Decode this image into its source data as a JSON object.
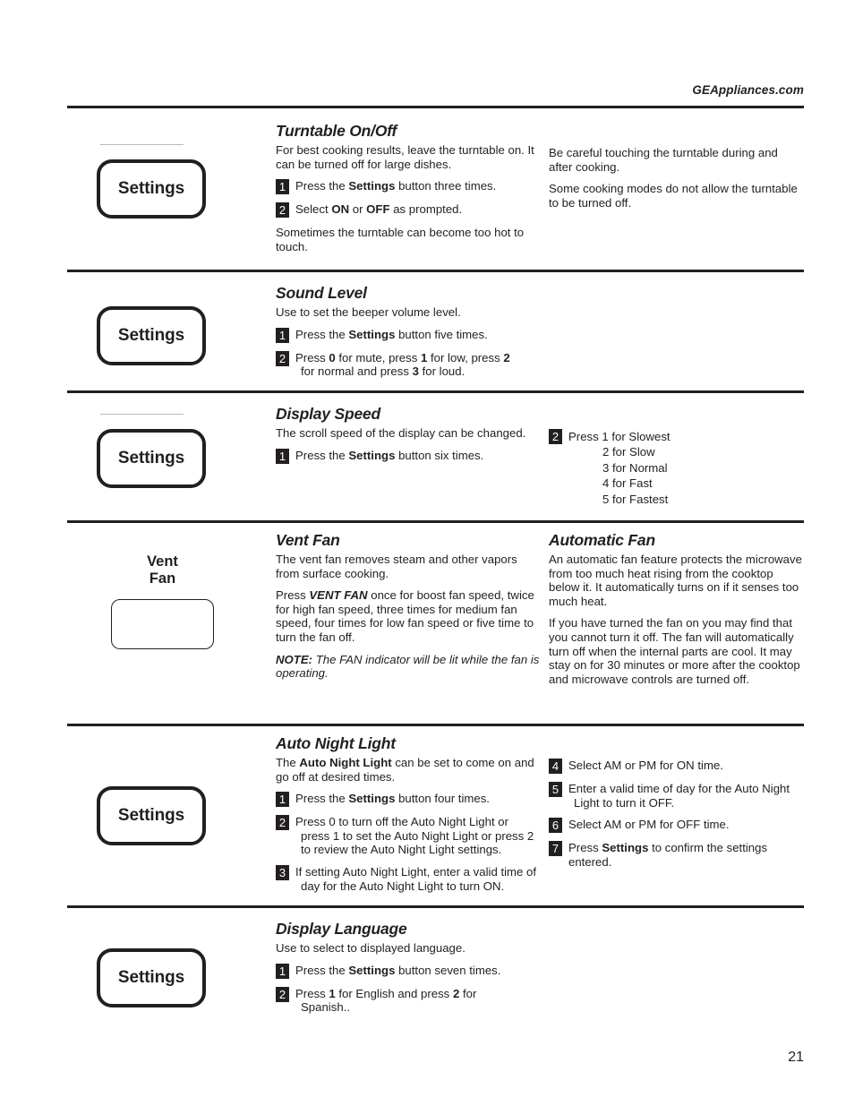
{
  "header": {
    "site": "GEAppliances.com"
  },
  "page_number": "21",
  "sections": [
    {
      "id": "turntable",
      "control": {
        "type": "settings-button",
        "label": "Settings",
        "hairline": true
      },
      "title": "Turntable On/Off",
      "intro": "For best cooking results, leave the turntable on. It can be turned off for large dishes.",
      "steps": [
        {
          "num": "1",
          "pre": "Press the ",
          "bold": "Settings",
          "post": " button three times."
        },
        {
          "num": "2",
          "pre": "Select ",
          "bold": "ON",
          "mid": " or ",
          "bold2": "OFF",
          "post": " as prompted."
        }
      ],
      "outro": "Sometimes the turntable can become too hot to touch.",
      "right_paragraphs": [
        "Be careful touching the turntable during and after cooking.",
        "Some cooking modes do not allow the turntable to be turned off."
      ]
    },
    {
      "id": "sound-level",
      "control": {
        "type": "settings-button",
        "label": "Settings",
        "hairline": false
      },
      "title": "Sound Level",
      "intro": "Use to set the beeper volume level.",
      "steps": [
        {
          "num": "1",
          "pre": "Press the ",
          "bold": "Settings",
          "post": " button five times."
        },
        {
          "num": "2",
          "text_html": "Press <b>0</b> for mute, press <b>1</b> for low, press <b>2</b><span class=\"indent\">for normal and press <b>3</b> for loud.</span>"
        }
      ],
      "right_paragraphs": []
    },
    {
      "id": "display-speed",
      "control": {
        "type": "settings-button",
        "label": "Settings",
        "hairline": true
      },
      "title": "Display Speed",
      "intro": "The scroll speed of the display can be changed.",
      "steps": [
        {
          "num": "1",
          "pre": "Press the ",
          "bold": "Settings",
          "post": " button six times."
        }
      ],
      "right_step": {
        "num": "2",
        "lines": [
          "Press 1 for Slowest",
          "2 for Slow",
          "3 for Normal",
          "4 for Fast",
          "5 for Fastest"
        ]
      }
    },
    {
      "id": "vent-fan",
      "control": {
        "type": "plain-button",
        "label": "Vent\nFan"
      },
      "title": "Vent Fan",
      "intro": "The vent fan removes steam and other vapors from surface cooking.",
      "paragraph2_html": "Press <b><i>VENT FAN</i></b> once for boost fan speed, twice for high fan speed, three times for medium fan speed, four times for low fan speed or five time to turn the fan off.",
      "note_label": "NOTE:",
      "note_text": " The FAN indicator will be lit while the fan is operating.",
      "right_title": "Automatic Fan",
      "right_paragraphs": [
        "An automatic fan feature protects the microwave from too much heat rising from the cooktop below it. It automatically turns on if it senses too much heat.",
        "If you have turned the fan on you may find that you cannot turn it off. The fan will automatically turn off when the internal parts are cool. It may stay on for 30 minutes or more after the cooktop and microwave controls are turned off."
      ]
    },
    {
      "id": "auto-night-light",
      "control": {
        "type": "settings-button",
        "label": "Settings",
        "hairline": false
      },
      "title": "Auto Night Light",
      "intro_html": "The <b>Auto Night Light</b> can be set to come on and go off at desired times.",
      "steps": [
        {
          "num": "1",
          "pre": "Press the ",
          "bold": "Settings",
          "post": " button four times."
        },
        {
          "num": "2",
          "text_html": "Press 0 to turn off the Auto Night Light or<span class=\"indent\">press 1 to set the Auto Night Light  or press 2</span><span class=\"indent\">to review the Auto Night Light settings.</span>"
        },
        {
          "num": "3",
          "text_html": "If setting Auto Night Light, enter a valid time of<span class=\"indent\">day for the Auto Night Light to turn ON.</span>"
        }
      ],
      "right_steps": [
        {
          "num": "4",
          "text_html": "Select AM or PM for ON time."
        },
        {
          "num": "5",
          "text_html": "Enter a valid time of day for the Auto Night<span class=\"indent\">Light to turn it OFF.</span>"
        },
        {
          "num": "6",
          "text_html": "Select AM or PM for OFF time."
        },
        {
          "num": "7",
          "text_html": "Press <b>Settings</b> to confirm the settings entered."
        }
      ]
    },
    {
      "id": "display-language",
      "control": {
        "type": "settings-button",
        "label": "Settings",
        "hairline": false
      },
      "title": "Display Language",
      "intro": "Use to select to displayed language.",
      "steps": [
        {
          "num": "1",
          "pre": "Press the ",
          "bold": "Settings",
          "post": " button seven times."
        },
        {
          "num": "2",
          "text_html": "Press <b>1</b> for English and press <b>2</b> for<span class=\"indent\">Spanish..</span>"
        }
      ],
      "right_paragraphs": []
    }
  ]
}
